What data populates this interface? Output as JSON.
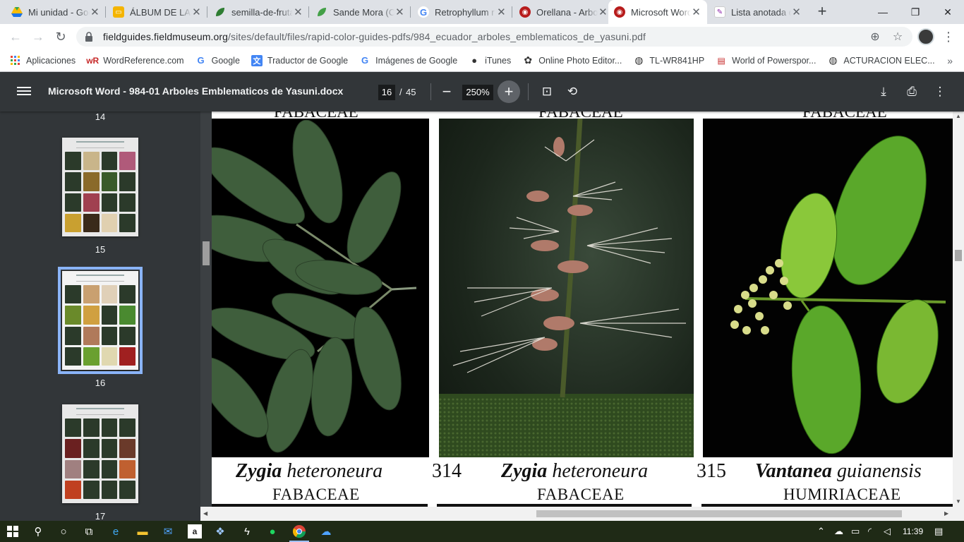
{
  "tabs": [
    {
      "title": "Mi unidad - Google Drive",
      "icon": "google-drive-icon",
      "color": "#1a73e8"
    },
    {
      "title": "ÁLBUM DE LA ESPECIE",
      "icon": "google-slides-icon",
      "color": "#f4b400"
    },
    {
      "title": "semilla-de-fruta",
      "icon": "leaf-icon",
      "color": "#2e7d32"
    },
    {
      "title": "Sande Mora (C",
      "icon": "leaf-icon",
      "color": "#43a047"
    },
    {
      "title": "Retrophyllum r",
      "icon": "google-icon",
      "color": "#4285f4"
    },
    {
      "title": "Orellana - Arbo",
      "icon": "fieldmuseum-icon",
      "color": "#b71c1c"
    },
    {
      "title": "Microsoft Word",
      "icon": "fieldmuseum-icon",
      "color": "#b71c1c",
      "active": true
    },
    {
      "title": "Lista anotada d",
      "icon": "pdf-doc-icon",
      "color": "#8e24aa"
    }
  ],
  "window": {
    "minimize": "—",
    "restore": "❐",
    "close": "✕",
    "newtab": "+"
  },
  "address": {
    "url_host": "fieldguides.fieldmuseum.org",
    "url_path": "/sites/default/files/rapid-color-guides-pdfs/984_ecuador_arboles_emblematicos_de_yasuni.pdf"
  },
  "bookmarks": [
    {
      "label": "Aplicaciones",
      "icon": "apps-grid-icon"
    },
    {
      "label": "WordReference.com",
      "icon": "wordreference-icon"
    },
    {
      "label": "Google",
      "icon": "google-icon"
    },
    {
      "label": "Traductor de Google",
      "icon": "translate-icon"
    },
    {
      "label": "Imágenes de Google",
      "icon": "google-icon"
    },
    {
      "label": "iTunes",
      "icon": "apple-icon"
    },
    {
      "label": "Online Photo Editor...",
      "icon": "photo-editor-icon"
    },
    {
      "label": "TL-WR841HP",
      "icon": "globe-icon"
    },
    {
      "label": "World of Powerspor...",
      "icon": "powersports-icon"
    },
    {
      "label": "ACTURACION ELEC...",
      "icon": "globe-icon"
    }
  ],
  "pdf": {
    "title": "Microsoft Word - 984-01 Arboles Emblematicos de Yasuni.docx",
    "page": "16",
    "sep": "/",
    "total": "45",
    "zoom": "250%"
  },
  "thumbnails": [
    {
      "num": "14"
    },
    {
      "num": "15"
    },
    {
      "num": "16",
      "selected": true
    },
    {
      "num": "17"
    }
  ],
  "species": [
    {
      "family_top": "FABACEAE",
      "num": "",
      "genus": "Zygia",
      "epithet": "heteroneura",
      "family": "FABACEAE"
    },
    {
      "family_top": "FABACEAE",
      "num": "314",
      "genus": "Zygia",
      "epithet": "heteroneura",
      "family": "FABACEAE"
    },
    {
      "family_top": "FABACEAE",
      "num": "315",
      "genus": "Vantanea",
      "epithet": "guianensis",
      "family": "HUMIRIACEAE"
    }
  ],
  "taskbar": {
    "clock": "11:39"
  }
}
